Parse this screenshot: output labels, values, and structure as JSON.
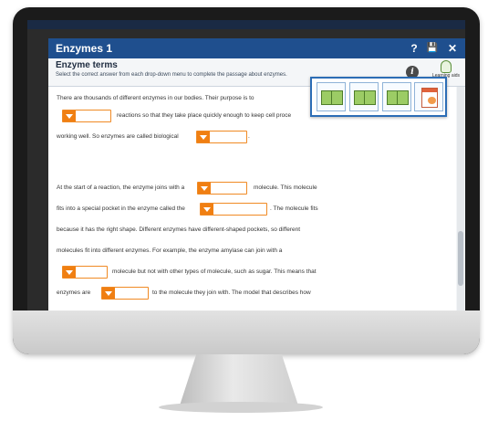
{
  "window": {
    "title": "Enzymes 1",
    "help_label": "?",
    "save_label": "💾",
    "close_label": "✕"
  },
  "header": {
    "heading": "Enzyme terms",
    "instruction": "Select the correct answer from each drop-down menu to complete the passage about enzymes.",
    "info_label": "i",
    "learning_aids_label": "Learning aids"
  },
  "passage": {
    "p1": {
      "l1": "There are thousands of different enzymes in our bodies. Their purpose is to",
      "l2_after": "reactions so that they take place quickly enough to keep cell proce",
      "l3_before": "working well. So enzymes are called biological",
      "l3_after": "."
    },
    "p2": {
      "l1_before": "At the start of a reaction, the enzyme joins with a",
      "l1_after": "molecule. This molecule",
      "l2_before": "fits into a special pocket in the enzyme called the",
      "l2_after": ". The molecule fits",
      "l3": "because it has the right shape. Different enzymes have different-shaped pockets, so different",
      "l4": "molecules fit into different enzymes. For example, the enzyme amylase can join with a",
      "l5_after": "molecule but not with other types of molecule, such as sugar. This means that",
      "l6_before": "enzymes are",
      "l6_after": "to the molecule they join with. The model that describes how"
    }
  },
  "learning_aids": [
    "book-icon",
    "book-icon",
    "book-icon",
    "document-icon"
  ],
  "colors": {
    "titlebar": "#1f4f8e",
    "dropdown_accent": "#f07f12",
    "panel_border": "#2c6db5"
  }
}
